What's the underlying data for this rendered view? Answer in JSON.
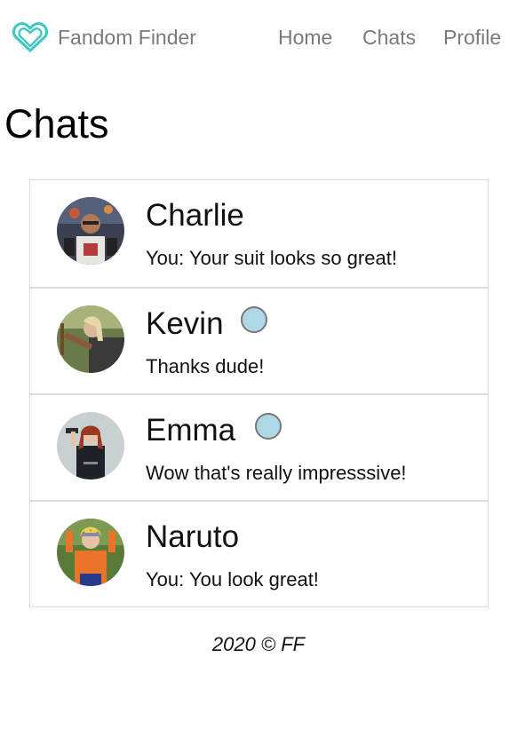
{
  "nav": {
    "brand": "Fandom Finder",
    "brand_color": "#40c9c0",
    "links": [
      {
        "label": "Home"
      },
      {
        "label": "Chats"
      },
      {
        "label": "Profile"
      }
    ]
  },
  "page_title": "Chats",
  "chats": [
    {
      "name": "Charlie",
      "preview": "You: Your suit looks so great!",
      "unread": false,
      "avatar": "avatar-charlie"
    },
    {
      "name": "Kevin",
      "preview": "Thanks dude!",
      "unread": true,
      "avatar": "avatar-kevin"
    },
    {
      "name": "Emma",
      "preview": "Wow that's really impresssive!",
      "unread": true,
      "avatar": "avatar-emma"
    },
    {
      "name": "Naruto",
      "preview": "You: You look great!",
      "unread": false,
      "avatar": "avatar-naruto"
    }
  ],
  "unread_dot_color": "#add8e6",
  "footer": "2020 © FF"
}
